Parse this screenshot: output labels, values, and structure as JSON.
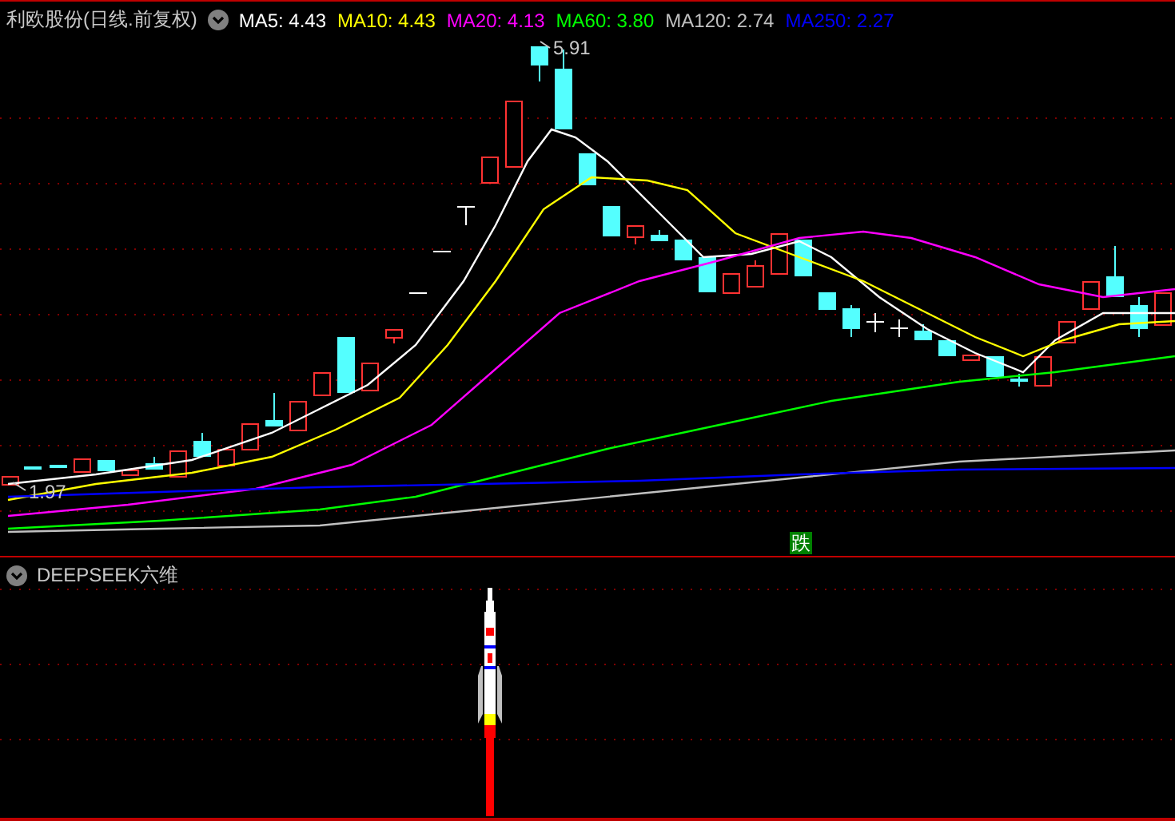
{
  "main_chart": {
    "title": "利欧股份(日线.前复权)",
    "indicators": [
      {
        "label": "MA5: 4.43",
        "color": "#ffffff"
      },
      {
        "label": "MA10: 4.43",
        "color": "#ffff00"
      },
      {
        "label": "MA20: 4.13",
        "color": "#ff00ff"
      },
      {
        "label": "MA60: 3.80",
        "color": "#00ff00"
      },
      {
        "label": "MA120: 2.74",
        "color": "#c0c0c0"
      },
      {
        "label": "MA250: 2.27",
        "color": "#0000ff"
      }
    ],
    "high_label": "5.91",
    "low_label": "1.97",
    "signal_badge": "跌"
  },
  "sub_chart": {
    "title": "DEEPSEEK六维"
  }
}
